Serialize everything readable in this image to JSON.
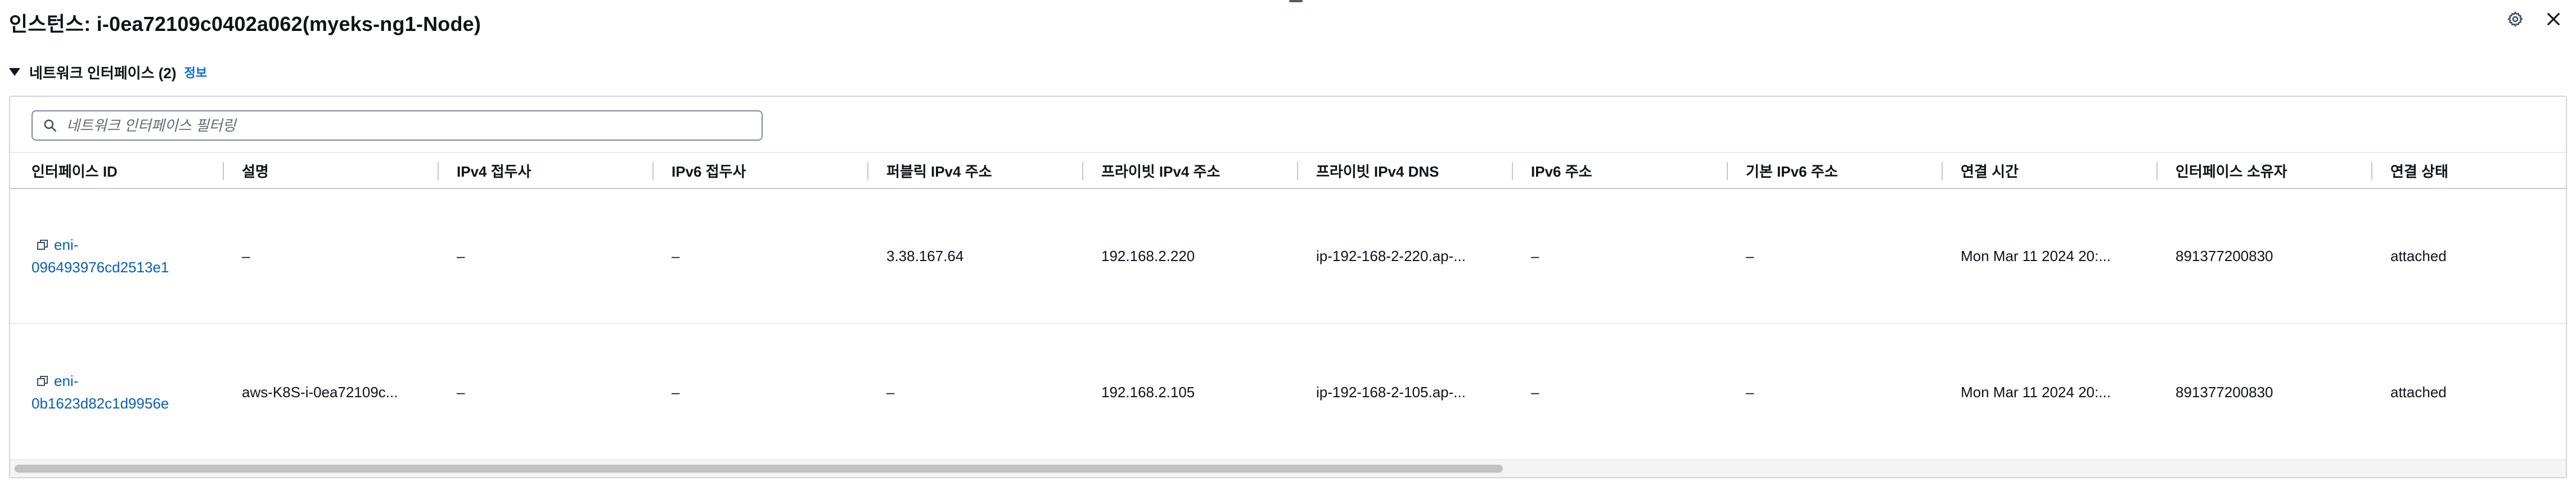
{
  "header": {
    "title": "인스턴스: i-0ea72109c0402a062(myeks-ng1-Node)",
    "settings_icon": "gear-icon",
    "close_icon": "close-icon"
  },
  "section": {
    "title": "네트워크 인터페이스 (2)",
    "info_link": "정보"
  },
  "filter": {
    "placeholder": "네트워크 인터페이스 필터링",
    "value": ""
  },
  "table": {
    "columns": [
      "인터페이스 ID",
      "설명",
      "IPv4 접두사",
      "IPv6 접두사",
      "퍼블릭 IPv4 주소",
      "프라이빗 IPv4 주소",
      "프라이빗 IPv4 DNS",
      "IPv6 주소",
      "기본 IPv6 주소",
      "연결 시간",
      "인터페이스 소유자",
      "연결 상태"
    ],
    "rows": [
      {
        "eni_line1": "eni-",
        "eni_line2": "096493976cd2513e1",
        "description": "–",
        "ipv4_prefix": "–",
        "ipv6_prefix": "–",
        "public_ipv4": "3.38.167.64",
        "private_ipv4": "192.168.2.220",
        "private_dns": "ip-192-168-2-220.ap-...",
        "ipv6": "–",
        "primary_ipv6": "–",
        "attach_time": "Mon Mar 11 2024 20:...",
        "owner": "891377200830",
        "status": "attached"
      },
      {
        "eni_line1": "eni-",
        "eni_line2": "0b1623d82c1d9956e",
        "description": "aws-K8S-i-0ea72109c...",
        "ipv4_prefix": "–",
        "ipv6_prefix": "–",
        "public_ipv4": "–",
        "private_ipv4": "192.168.2.105",
        "private_dns": "ip-192-168-2-105.ap-...",
        "ipv6": "–",
        "primary_ipv6": "–",
        "attach_time": "Mon Mar 11 2024 20:...",
        "owner": "891377200830",
        "status": "attached"
      }
    ]
  },
  "colors": {
    "link": "#0a5fb8",
    "info": "#006ce0",
    "text": "#0f141a",
    "border": "#c6c6cd"
  }
}
